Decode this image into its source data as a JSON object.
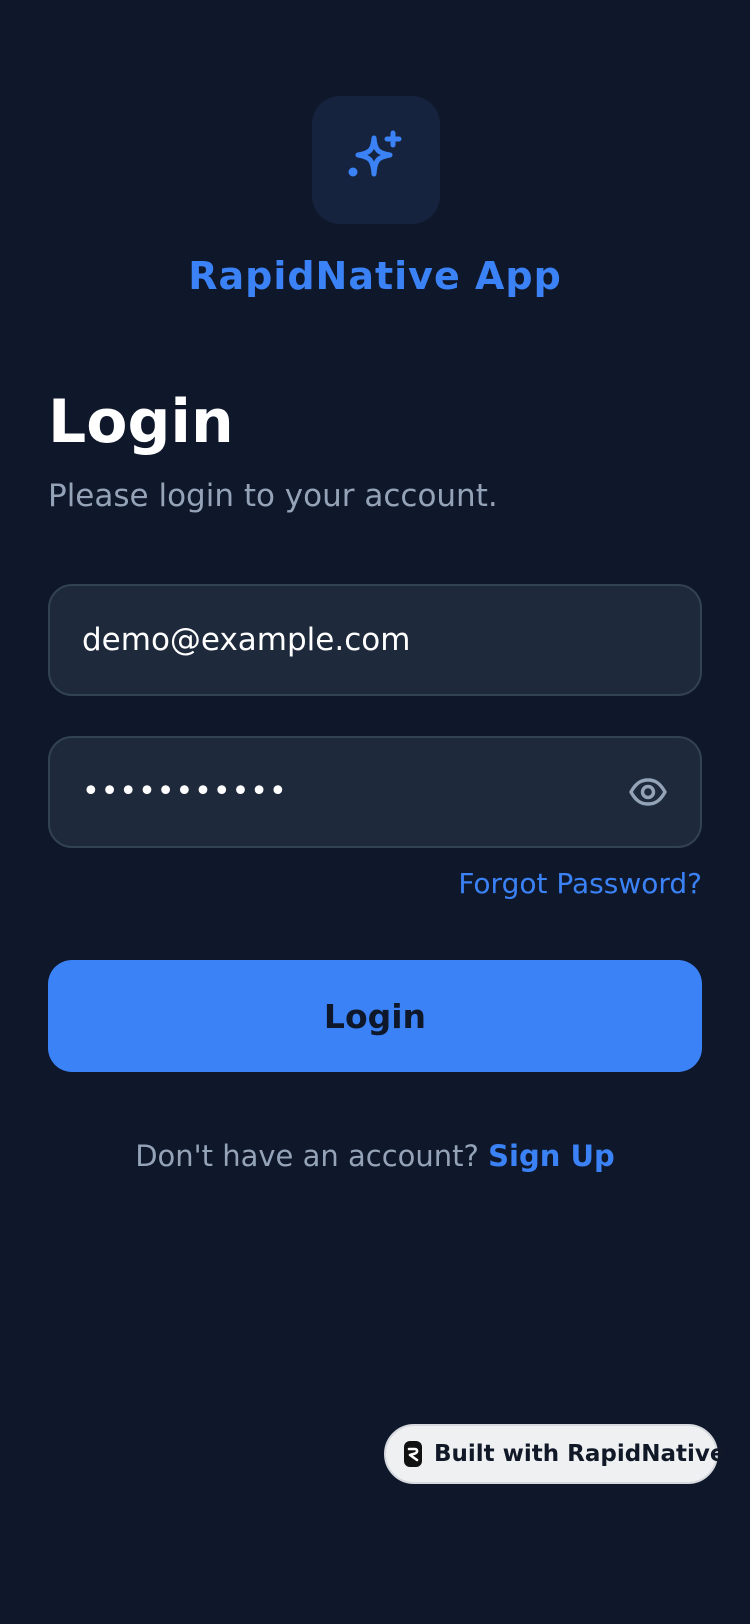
{
  "app": {
    "name": "RapidNative App",
    "logo_icon": "sparkles-icon"
  },
  "login": {
    "title": "Login",
    "subtitle": "Please login to your account.",
    "email_value": "demo@example.com",
    "password_mask": "•••••••••••",
    "password_toggle_icon": "eye-icon",
    "forgot_password": "Forgot Password?",
    "button_label": "Login",
    "signup_prompt": "Don't have an account?",
    "signup_link": "Sign Up"
  },
  "badge": {
    "label": "Built with RapidNative",
    "icon": "rapidnative-logo-icon"
  },
  "colors": {
    "background": "#0f172a",
    "accent": "#3b82f6",
    "field_background": "#1e293b",
    "muted_text": "#94a3b8"
  }
}
